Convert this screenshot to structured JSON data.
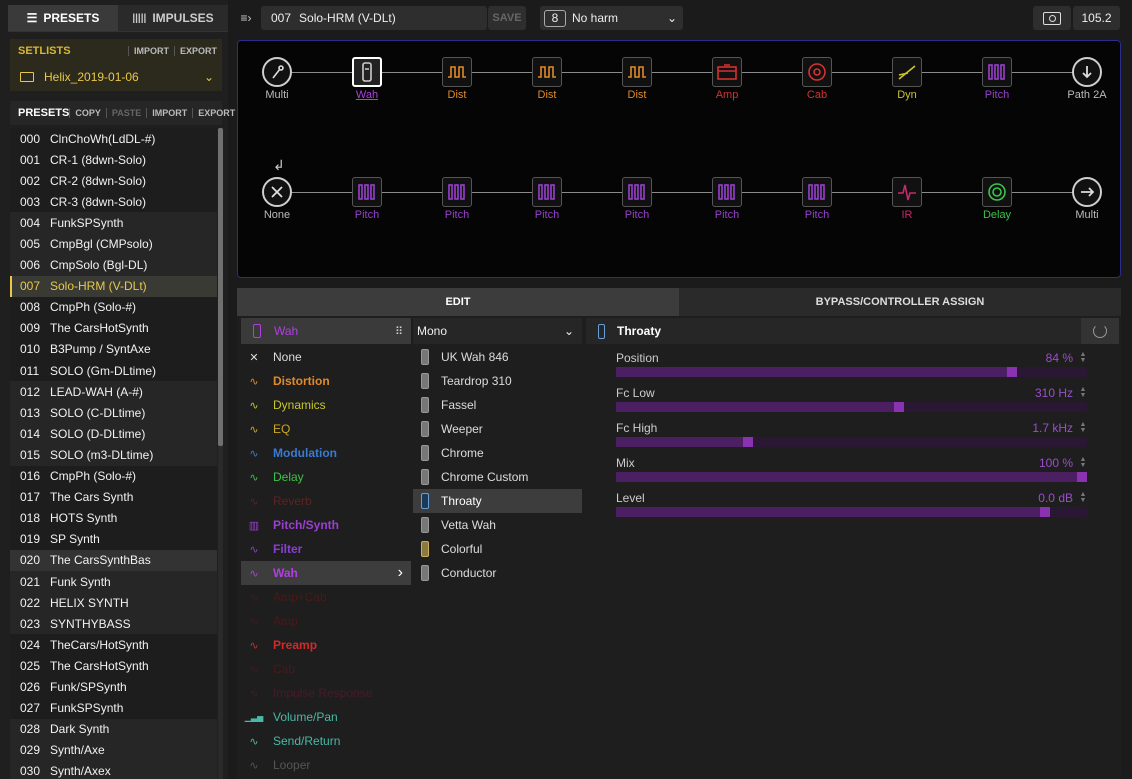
{
  "colors": {
    "accent": "#e8c84a",
    "wah": "#b03fe0",
    "dist": "#e08a2a",
    "amp": "#d83030",
    "dyn": "#c9c52a",
    "pitch": "#9a3fd0",
    "delay": "#3cc34a",
    "ir": "#c42a6a"
  },
  "left_tabs": [
    {
      "label": "PRESETS",
      "icon": "list-icon"
    },
    {
      "label": "IMPULSES",
      "icon": "waveform-icon"
    }
  ],
  "setlists": {
    "title": "SETLISTS",
    "import": "IMPORT",
    "export": "EXPORT",
    "selected": "Helix_2019-01-06"
  },
  "presets": {
    "title": "PRESETS",
    "copy": "COPY",
    "paste": "PASTE",
    "import": "IMPORT",
    "export": "EXPORT",
    "items": [
      {
        "num": "000",
        "name": "ClnChoWh(LdDL-#)"
      },
      {
        "num": "001",
        "name": "CR-1 (8dwn-Solo)"
      },
      {
        "num": "002",
        "name": "CR-2 (8dwn-Solo)"
      },
      {
        "num": "003",
        "name": "CR-3 (8dwn-Solo)"
      },
      {
        "num": "004",
        "name": "FunkSPSynth"
      },
      {
        "num": "005",
        "name": "CmpBgl (CMPsolo)"
      },
      {
        "num": "006",
        "name": "CmpSolo (Bgl-DL)"
      },
      {
        "num": "007",
        "name": "Solo-HRM (V-DLt)"
      },
      {
        "num": "008",
        "name": "CmpPh (Solo-#)"
      },
      {
        "num": "009",
        "name": "The CarsHotSynth"
      },
      {
        "num": "010",
        "name": "B3Pump / SyntAxe"
      },
      {
        "num": "011",
        "name": "SOLO (Gm-DLtime)"
      },
      {
        "num": "012",
        "name": "LEAD-WAH (A-#)"
      },
      {
        "num": "013",
        "name": "SOLO (C-DLtime)"
      },
      {
        "num": "014",
        "name": "SOLO (D-DLtime)"
      },
      {
        "num": "015",
        "name": "SOLO (m3-DLtime)"
      },
      {
        "num": "016",
        "name": "CmpPh (Solo-#)"
      },
      {
        "num": "017",
        "name": "The Cars Synth"
      },
      {
        "num": "018",
        "name": "HOTS Synth"
      },
      {
        "num": "019",
        "name": "SP Synth"
      },
      {
        "num": "020",
        "name": "The CarsSynthBas"
      },
      {
        "num": "021",
        "name": "Funk Synth"
      },
      {
        "num": "022",
        "name": "HELIX SYNTH"
      },
      {
        "num": "023",
        "name": "SYNTHYBASS"
      },
      {
        "num": "024",
        "name": "TheCars/HotSynth"
      },
      {
        "num": "025",
        "name": "The CarsHotSynth"
      },
      {
        "num": "026",
        "name": "Funk/SPSynth"
      },
      {
        "num": "027",
        "name": "FunkSPSynth"
      },
      {
        "num": "028",
        "name": "Dark Synth"
      },
      {
        "num": "029",
        "name": "Synth/Axe"
      },
      {
        "num": "030",
        "name": "Synth/Axex"
      }
    ]
  },
  "topbar": {
    "preset_num": "007",
    "preset_name": "Solo-HRM (V-DLt)",
    "save": "SAVE",
    "snapshot_num": "8",
    "snapshot_name": "No harm",
    "tempo": "105.2"
  },
  "path1": [
    {
      "label": "Multi",
      "kind": "node-in"
    },
    {
      "label": "Wah",
      "kind": "wah"
    },
    {
      "label": "Dist",
      "kind": "dist"
    },
    {
      "label": "Dist",
      "kind": "dist"
    },
    {
      "label": "Dist",
      "kind": "dist"
    },
    {
      "label": "Amp",
      "kind": "amp"
    },
    {
      "label": "Cab",
      "kind": "cab"
    },
    {
      "label": "Dyn",
      "kind": "dyn"
    },
    {
      "label": "Pitch",
      "kind": "pitch"
    },
    {
      "label": "Path 2A",
      "kind": "node-out"
    }
  ],
  "path2": [
    {
      "label": "None",
      "kind": "node-none"
    },
    {
      "label": "Pitch",
      "kind": "pitch"
    },
    {
      "label": "Pitch",
      "kind": "pitch"
    },
    {
      "label": "Pitch",
      "kind": "pitch"
    },
    {
      "label": "Pitch",
      "kind": "pitch"
    },
    {
      "label": "Pitch",
      "kind": "pitch"
    },
    {
      "label": "Pitch",
      "kind": "pitch"
    },
    {
      "label": "IR",
      "kind": "ir"
    },
    {
      "label": "Delay",
      "kind": "delay"
    },
    {
      "label": "Multi",
      "kind": "node-out"
    }
  ],
  "edit_tabs": [
    "EDIT",
    "BYPASS/CONTROLLER ASSIGN"
  ],
  "category_header": "Wah",
  "mono_header": "Mono",
  "model_header": "Throaty",
  "categories": [
    {
      "label": "None",
      "color": "#dddddd",
      "icon": "none-icon"
    },
    {
      "label": "Distortion",
      "color": "#e08a2a",
      "icon": "distortion-icon"
    },
    {
      "label": "Dynamics",
      "color": "#c9c52a",
      "icon": "dynamics-icon"
    },
    {
      "label": "EQ",
      "color": "#c9a82a",
      "icon": "eq-icon"
    },
    {
      "label": "Modulation",
      "color": "#3a7ad0",
      "icon": "modulation-icon"
    },
    {
      "label": "Delay",
      "color": "#3cc34a",
      "icon": "delay-icon"
    },
    {
      "label": "Reverb",
      "color": "#5a2424",
      "icon": "reverb-icon"
    },
    {
      "label": "Pitch/Synth",
      "color": "#9a3fd0",
      "icon": "pitch-icon"
    },
    {
      "label": "Filter",
      "color": "#8a3fd0",
      "icon": "filter-icon"
    },
    {
      "label": "Wah",
      "color": "#b03fe0",
      "icon": "wah-icon"
    },
    {
      "label": "Amp+Cab",
      "color": "#4a1a1a",
      "icon": "ampcab-icon"
    },
    {
      "label": "Amp",
      "color": "#4a1a1a",
      "icon": "amp-icon"
    },
    {
      "label": "Preamp",
      "color": "#d02a2a",
      "icon": "preamp-icon"
    },
    {
      "label": "Cab",
      "color": "#4a1a1a",
      "icon": "cab-icon"
    },
    {
      "label": "Impulse Response",
      "color": "#4a1a2a",
      "icon": "ir-icon"
    },
    {
      "label": "Volume/Pan",
      "color": "#4ab8a8",
      "icon": "volume-icon"
    },
    {
      "label": "Send/Return",
      "color": "#4ab8a8",
      "icon": "sendreturn-icon"
    },
    {
      "label": "Looper",
      "color": "#555555",
      "icon": "looper-icon"
    }
  ],
  "models": [
    "UK Wah 846",
    "Teardrop 310",
    "Fassel",
    "Weeper",
    "Chrome",
    "Chrome Custom",
    "Throaty",
    "Vetta Wah",
    "Colorful",
    "Conductor"
  ],
  "params": [
    {
      "label": "Position",
      "value": "84 %",
      "level": 0.84
    },
    {
      "label": "Fc Low",
      "value": "310 Hz",
      "level": 0.6
    },
    {
      "label": "Fc High",
      "value": "1.7 kHz",
      "level": 0.28
    },
    {
      "label": "Mix",
      "value": "100 %",
      "level": 1.0
    },
    {
      "label": "Level",
      "value": "0.0 dB",
      "level": 0.91
    }
  ]
}
